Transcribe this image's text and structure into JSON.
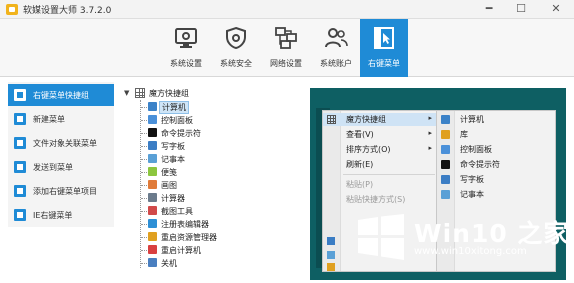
{
  "app": {
    "title": "软媒设置大师 3.7.2.0",
    "window_controls": [
      "━",
      "☐",
      "✕"
    ]
  },
  "toolbar": {
    "items": [
      {
        "label": "系统设置",
        "icon": "monitor-gear-icon"
      },
      {
        "label": "系统安全",
        "icon": "shield-gear-icon"
      },
      {
        "label": "网络设置",
        "icon": "network-icon"
      },
      {
        "label": "系统账户",
        "icon": "users-icon"
      },
      {
        "label": "右键菜单",
        "icon": "cursor-window-icon",
        "active": true
      }
    ],
    "active_color": "#1f8bd6"
  },
  "sidebar": {
    "items": [
      {
        "label": "右键菜单快捷组",
        "active": true
      },
      {
        "label": "新建菜单"
      },
      {
        "label": "文件对象关联菜单"
      },
      {
        "label": "发送到菜单"
      },
      {
        "label": "添加右键菜单项目"
      },
      {
        "label": "IE右键菜单"
      }
    ]
  },
  "tree": {
    "root": {
      "expander": "▼",
      "label": "魔方快捷组"
    },
    "items": [
      {
        "label": "计算机",
        "color": "#3b82c8",
        "selected": true
      },
      {
        "label": "控制面板",
        "color": "#4a90d9"
      },
      {
        "label": "命令提示符",
        "color": "#111111"
      },
      {
        "label": "写字板",
        "color": "#3b7dc4"
      },
      {
        "label": "记事本",
        "color": "#5aa0d6"
      },
      {
        "label": "便笺",
        "color": "#8cc63f"
      },
      {
        "label": "画图",
        "color": "#e07b39"
      },
      {
        "label": "计算器",
        "color": "#6b7b8c"
      },
      {
        "label": "截图工具",
        "color": "#d14a4a"
      },
      {
        "label": "注册表编辑器",
        "color": "#2d8fd5"
      },
      {
        "label": "重启资源管理器",
        "color": "#e0a020"
      },
      {
        "label": "重启计算机",
        "color": "#d94040"
      },
      {
        "label": "关机",
        "color": "#4a7fc0"
      }
    ]
  },
  "preview": {
    "menu": {
      "items": [
        {
          "label": "魔方快捷组",
          "arrow": "▸",
          "highlight": true,
          "icon": "grid-icon"
        },
        {
          "label": "查看(V)",
          "arrow": "▸"
        },
        {
          "label": "排序方式(O)",
          "arrow": "▸"
        },
        {
          "label": "刷新(E)"
        },
        {
          "label": "粘贴(P)",
          "disabled": true
        },
        {
          "label": "粘贴快捷方式(S)",
          "disabled": true
        }
      ]
    },
    "submenu": {
      "items": [
        {
          "label": "计算机",
          "color": "#3b82c8"
        },
        {
          "label": "库",
          "color": "#e0a020"
        },
        {
          "label": "控制面板",
          "color": "#4a90d9"
        },
        {
          "label": "命令提示符",
          "color": "#111111"
        },
        {
          "label": "写字板",
          "color": "#3b7dc4"
        },
        {
          "label": "记事本",
          "color": "#5aa0d6"
        }
      ]
    },
    "background_color": "#0e5f63"
  },
  "watermark": {
    "title": "Win10 之家",
    "url": "www.win10xitong.com"
  }
}
